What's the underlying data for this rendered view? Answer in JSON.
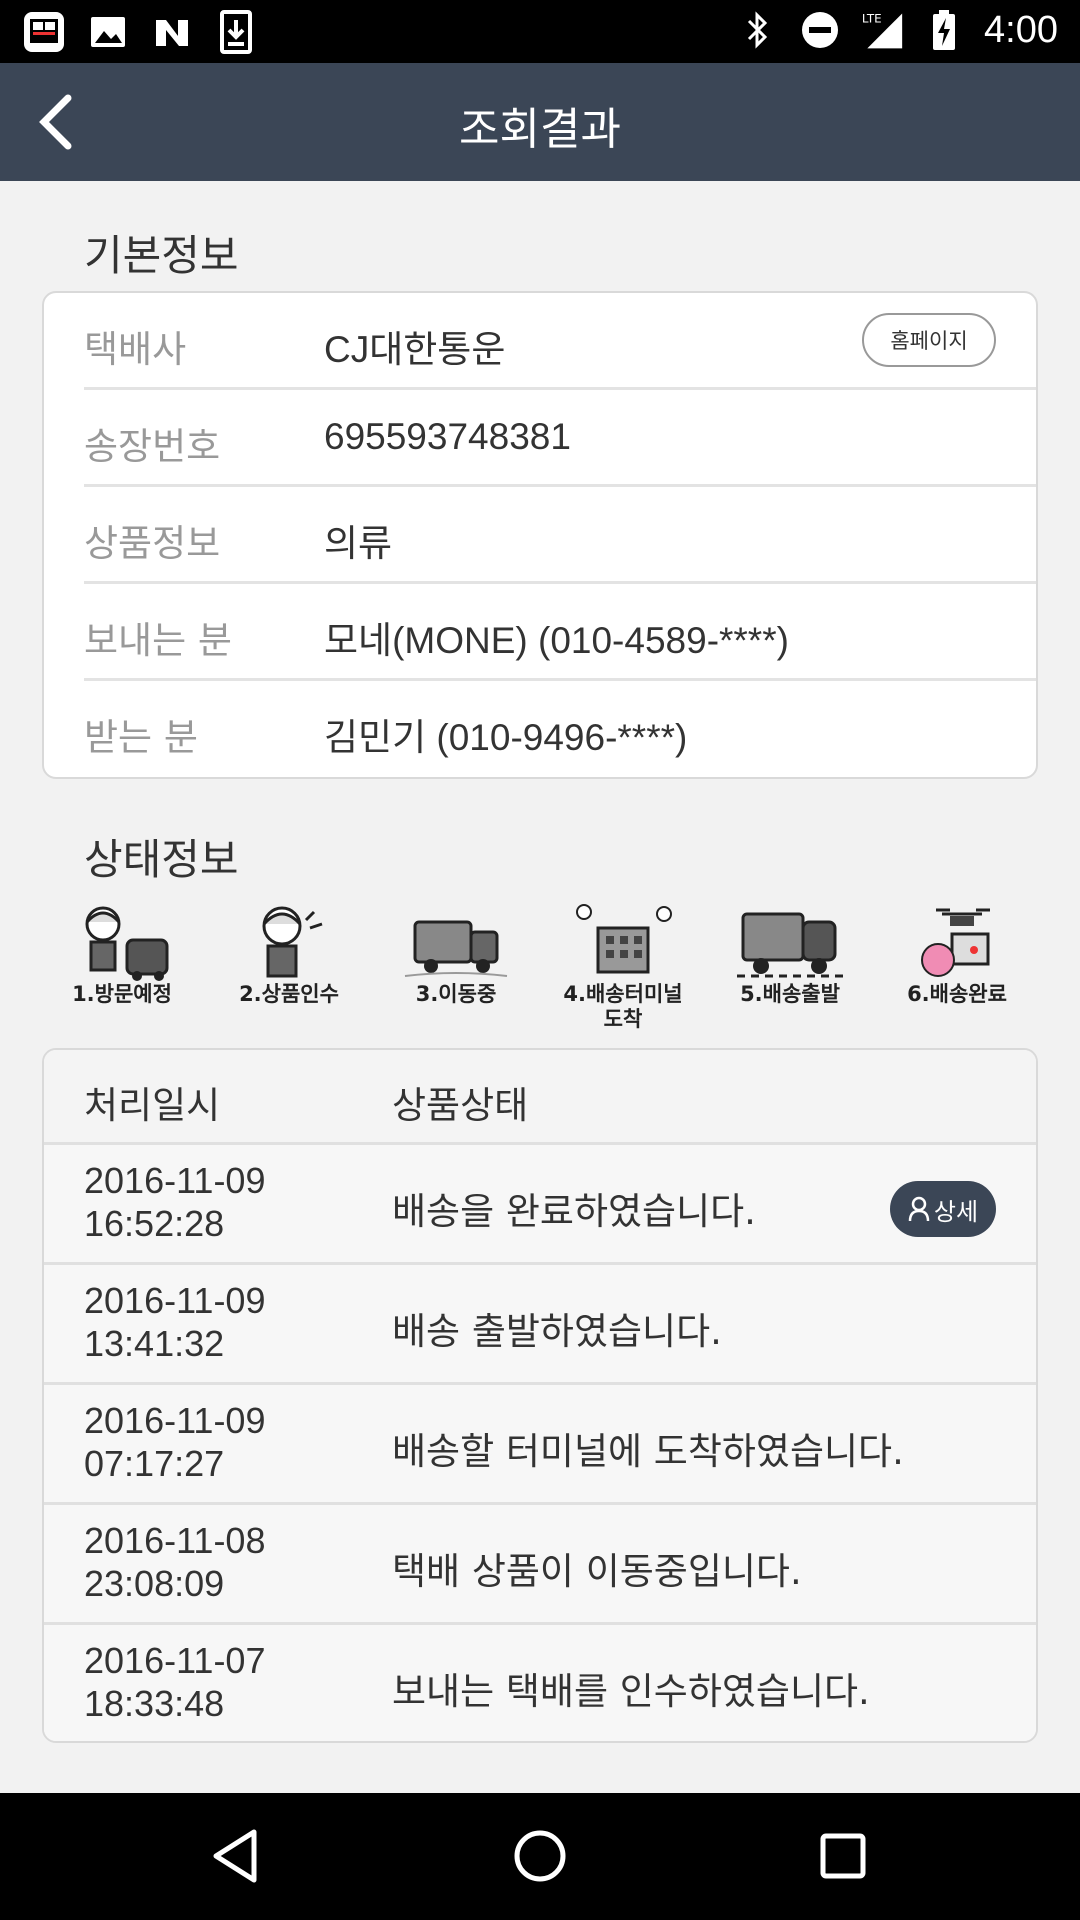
{
  "status_bar": {
    "time": "4:00",
    "network": "LTE"
  },
  "app_bar": {
    "title": "조회결과"
  },
  "basic_info": {
    "section_title": "기본정보",
    "homepage_label": "홈페이지",
    "rows": [
      {
        "label": "택배사",
        "value": "CJ대한통운"
      },
      {
        "label": "송장번호",
        "value": "695593748381"
      },
      {
        "label": "상품정보",
        "value": "의류"
      },
      {
        "label": "보내는 분",
        "value": "모네(MONE) (010-4589-****)"
      },
      {
        "label": "받는 분",
        "value": "김민기 (010-9496-****)"
      }
    ]
  },
  "status_info": {
    "section_title": "상태정보",
    "steps": [
      {
        "label": "1.방문예정"
      },
      {
        "label": "2.상품인수"
      },
      {
        "label": "3.이동중"
      },
      {
        "label": "4.배송터미널\n도착"
      },
      {
        "label": "5.배송출발"
      },
      {
        "label": "6.배송완료"
      }
    ],
    "table": {
      "header_date": "처리일시",
      "header_status": "상품상태",
      "detail_label": "상세",
      "rows": [
        {
          "date": "2016-11-09",
          "time": "16:52:28",
          "status": "배송을 완료하였습니다."
        },
        {
          "date": "2016-11-09",
          "time": "13:41:32",
          "status": "배송 출발하였습니다."
        },
        {
          "date": "2016-11-09",
          "time": "07:17:27",
          "status": "배송할 터미널에 도착하였습니다."
        },
        {
          "date": "2016-11-08",
          "time": "23:08:09",
          "status": "택배 상품이 이동중입니다."
        },
        {
          "date": "2016-11-07",
          "time": "18:33:48",
          "status": "보내는 택배를 인수하였습니다."
        }
      ]
    }
  },
  "icons": {
    "back": "chevron-left-icon",
    "nav": [
      "back-triangle-icon",
      "home-circle-icon",
      "recents-square-icon"
    ]
  },
  "colors": {
    "app_bar": "#3b4656",
    "detail_button": "#3b4656"
  }
}
